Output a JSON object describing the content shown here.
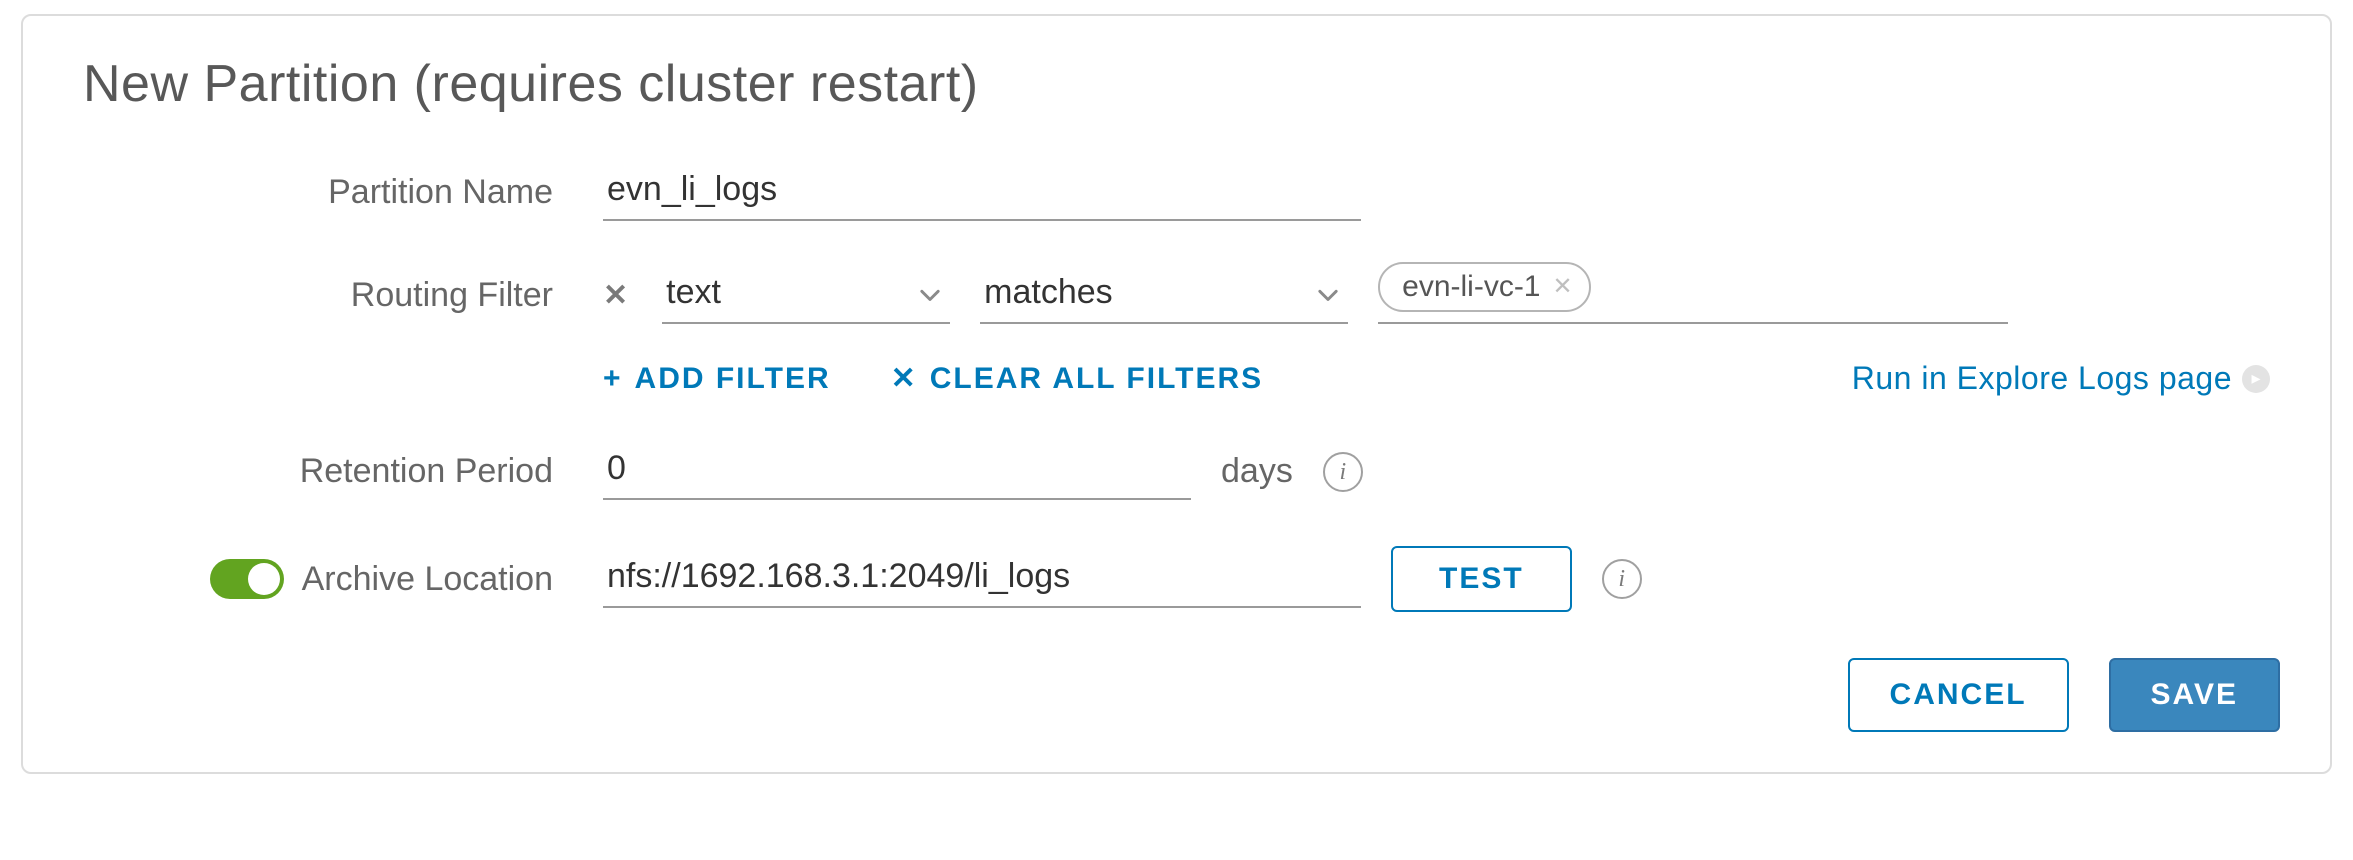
{
  "title": "New Partition (requires cluster restart)",
  "labels": {
    "partition_name": "Partition Name",
    "routing_filter": "Routing Filter",
    "retention_period": "Retention Period",
    "archive_location": "Archive Location"
  },
  "partition_name": {
    "value": "evn_li_logs"
  },
  "routing_filter": {
    "field_select": "text",
    "operator_select": "matches",
    "tag_value": "evn-li-vc-1"
  },
  "filter_actions": {
    "add_filter_label": "ADD FILTER",
    "clear_all_label": "CLEAR ALL FILTERS",
    "run_link_label": "Run in Explore Logs page"
  },
  "retention": {
    "value": "0",
    "unit_label": "days"
  },
  "archive": {
    "enabled": true,
    "value": "nfs://1692.168.3.1:2049/li_logs",
    "test_label": "TEST"
  },
  "footer": {
    "cancel_label": "CANCEL",
    "save_label": "SAVE"
  }
}
